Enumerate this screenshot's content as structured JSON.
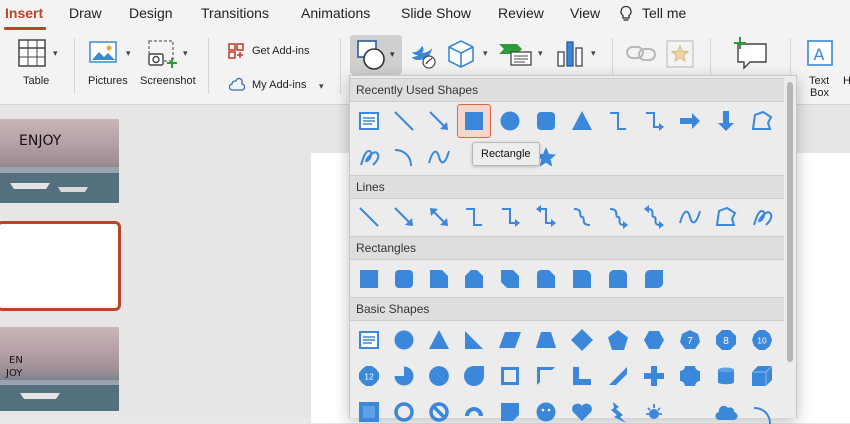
{
  "tabs": {
    "insert": "Insert",
    "draw": "Draw",
    "design": "Design",
    "transitions": "Transitions",
    "animations": "Animations",
    "slide_show": "Slide Show",
    "review": "Review",
    "view": "View",
    "tell_me": "Tell me"
  },
  "ribbon": {
    "table_label": "Table",
    "pictures_label": "Pictures",
    "screenshot_label": "Screenshot",
    "get_addins_label": "Get Add-ins",
    "my_addins_label": "My Add-ins",
    "text_box_line1": "Text",
    "text_box_line2": "Box",
    "cut_off_label": "H"
  },
  "thumbnails": {
    "slide1_title": "ENJOY",
    "slide3_title_line1": "EN",
    "slide3_title_line2": "JOY"
  },
  "shapes_panel": {
    "sections": {
      "recent": "Recently Used Shapes",
      "lines": "Lines",
      "rectangles": "Rectangles",
      "basic": "Basic Shapes"
    },
    "tooltip": "Rectangle",
    "badges": [
      "7",
      "8",
      "10",
      "12"
    ],
    "recent_row1": [
      "text-box-shape-icon",
      "line-shape-icon",
      "arrow-line-shape-icon",
      "rectangle-shape-icon",
      "oval-shape-icon",
      "rounded-rectangle-shape-icon",
      "triangle-shape-icon",
      "elbow-connector-shape-icon",
      "elbow-arrow-connector-shape-icon",
      "right-arrow-shape-icon",
      "down-arrow-shape-icon",
      "freeform-shape-icon"
    ],
    "recent_row2": [
      "scribble-shape-icon",
      "arc-shape-icon",
      "curve-shape-icon",
      "curved-connector-shape-icon",
      "curved-arrow-connector-shape-icon",
      "star-shape-icon"
    ],
    "lines_row": [
      "line",
      "arrow",
      "double-arrow",
      "elbow-connector",
      "elbow-arrow-connector",
      "elbow-double-arrow-connector",
      "curved-connector",
      "curved-arrow-connector",
      "curved-double-arrow-connector",
      "curve",
      "freeform",
      "scribble"
    ],
    "rectangles_row": [
      "rectangle",
      "rounded-rectangle",
      "snip-single-corner-rectangle",
      "snip-same-side-corner-rectangle",
      "snip-diagonal-corner-rectangle",
      "snip-and-round-single-corner-rectangle",
      "round-single-corner-rectangle",
      "round-same-side-corner-rectangle",
      "round-diagonal-corner-rectangle"
    ],
    "basic_row1": [
      "text-box",
      "oval",
      "isosceles-triangle",
      "right-triangle",
      "parallelogram",
      "trapezoid",
      "diamond",
      "regular-pentagon",
      "hexagon",
      "heptagon",
      "octagon",
      "decagon"
    ],
    "basic_row2": [
      "dodecagon",
      "pie",
      "chord",
      "teardrop",
      "frame",
      "half-frame",
      "l-shape",
      "diagonal-stripe",
      "cross",
      "plaque",
      "can",
      "cube"
    ],
    "basic_row3": [
      "bevel",
      "donut",
      "no-symbol",
      "block-arc",
      "folded-corner",
      "smiley-face",
      "heart",
      "lightning-bolt",
      "sun",
      "moon",
      "cloud",
      "arc"
    ]
  },
  "colors": {
    "accent": "#b7472a",
    "shape_fill": "#3b87d9"
  }
}
